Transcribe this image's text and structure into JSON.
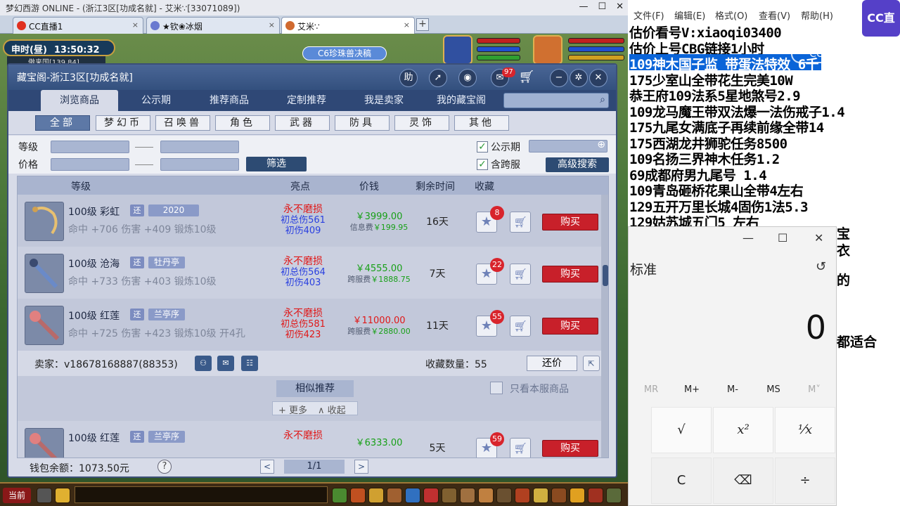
{
  "game_window": {
    "title": "梦幻西游 ONLINE - (浙江3区[功成名就] - 艾米∵[33071089])",
    "tabs": [
      {
        "label": "CC直播1",
        "close": "×"
      },
      {
        "label": "★钦❀冰烟",
        "close": "×"
      },
      {
        "label": "艾米∵",
        "close": "×"
      }
    ],
    "new_tab": "+",
    "clock": {
      "period": "申时(昼)",
      "time": "13:50:32"
    },
    "location": "傲来国[139,84]",
    "banner": "C6珍珠兽决稿",
    "bottom": {
      "current": "当前"
    }
  },
  "cbg": {
    "title": "藏宝阁-浙江3区[功成名就]",
    "toolbar": {
      "help": "助",
      "mail_badge": "97"
    },
    "nav_tabs": [
      "浏览商品",
      "公示期",
      "推荐商品",
      "定制推荐",
      "我是卖家",
      "我的藏宝阁"
    ],
    "categories": [
      "全部",
      "梦幻币",
      "召唤兽",
      "角色",
      "武器",
      "防具",
      "灵饰",
      "其他"
    ],
    "filter": {
      "level_label": "等级",
      "price_label": "价格",
      "filter_button": "筛选",
      "public_label": "公示期",
      "cross_label": "含跨服",
      "advanced_button": "高级搜索"
    },
    "list_headers": {
      "level": "等级",
      "highlight": "亮点",
      "price": "价钱",
      "remain": "剩余时间",
      "fav": "收藏"
    },
    "items": [
      {
        "name": "100级 彩虹",
        "huan": "还",
        "tag": "2020",
        "stats": "命中 +706 伤害 +409 锻炼10级",
        "hl1": "永不磨损",
        "hl2": "初总伤561",
        "hl3": "初伤409",
        "price": "￥3999.00",
        "fee_label": "信息费",
        "fee": "￥199.95",
        "remain": "16天",
        "fav_count": "8",
        "buy": "购买"
      },
      {
        "name": "100级 沧海",
        "huan": "还",
        "tag": "牡丹亭",
        "stats": "命中 +733 伤害 +403 锻炼10级",
        "hl1": "永不磨损",
        "hl2": "初总伤564",
        "hl3": "初伤403",
        "price": "￥4555.00",
        "fee_label": "跨服费",
        "fee": "￥1888.75",
        "remain": "7天",
        "fav_count": "22",
        "buy": "购买"
      },
      {
        "name": "100级 红莲",
        "huan": "还",
        "tag": "兰亭序",
        "stats": "命中 +725 伤害 +423 锻炼10级 开4孔",
        "hl1": "永不磨损",
        "hl2": "初总伤581",
        "hl3": "初伤423",
        "price": "￥11000.00",
        "fee_label": "跨服费",
        "fee": "￥2880.00",
        "remain": "11天",
        "fav_count": "55",
        "buy": "购买"
      },
      {
        "name": "100级 红莲",
        "huan": "还",
        "tag": "兰亭序",
        "stats": "",
        "hl1": "永不磨损",
        "hl2": "",
        "hl3": "",
        "price": "￥6333.00",
        "fee_label": "",
        "fee": "",
        "remain": "5天",
        "fav_count": "59",
        "buy": "购买"
      }
    ],
    "seller": {
      "label": "卖家：",
      "name": "v18678168887(88353)",
      "fav_label": "收藏数量：",
      "fav_count": "55",
      "bargain": "还价"
    },
    "similar": {
      "label": "相似推荐",
      "more": "+ 更多",
      "collapse": "∧ 收起",
      "only_server": "只看本服商品"
    },
    "footer": {
      "wallet_label": "钱包余额：",
      "wallet": "1073.50元",
      "help": "?",
      "prev": "<",
      "page": "1/1",
      "next": ">"
    }
  },
  "notepad": {
    "menu": [
      "文件(F)",
      "编辑(E)",
      "格式(O)",
      "查看(V)",
      "帮助(H)"
    ],
    "lines": [
      "估价看号V:xiaoqi03400",
      "估价上号CBG链接1小时",
      "109神木国子监 带蛋法特效 6千",
      "175少室山全带花生完美10W",
      "恭王府109法系5星地煞号2.9",
      "109龙马魔王带双法爆一法伤戒子1.4",
      "175九尾女满底子再续前缘全带14",
      "175西湖龙井狮驼任务8500",
      "109名扬三界神木任务1.2",
      "69成都府男九尾号  1.4",
      "109青岛砸桥花果山全带4左右",
      "129五开万里长城4固伤1法5.3",
      "129姑苏城五门5 左右"
    ],
    "overflow": [
      "宝",
      "衣",
      "的",
      "都适合"
    ],
    "cc_logo": "CC直播",
    "watermark": "CC直播"
  },
  "calculator": {
    "mode": "标准",
    "display": "0",
    "window_controls": [
      "—",
      "☐",
      "✕"
    ],
    "memory": [
      "MC",
      "MR",
      "M+",
      "M-",
      "MS",
      "M˅"
    ],
    "keys": [
      "√",
      "x²",
      "⅟x",
      "C",
      "⌫",
      "÷"
    ]
  }
}
